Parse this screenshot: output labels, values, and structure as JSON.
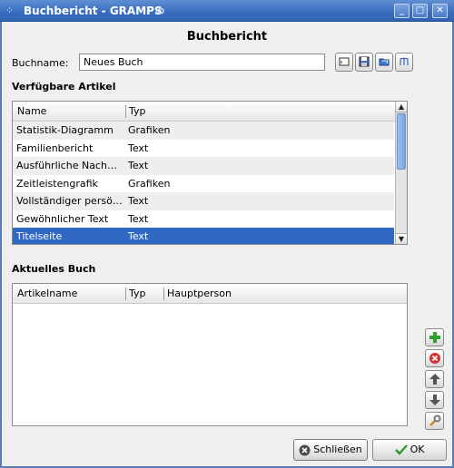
{
  "window": {
    "title": "Buchbericht - GRAMPS",
    "menu_icon": "window-menu-icon",
    "controls": {
      "minimize": "_",
      "maximize": "□",
      "close": "✕"
    }
  },
  "dialog": {
    "heading": "Buchbericht",
    "bookname_label": "Buchname:",
    "bookname_value": "Neues Buch",
    "toolbar_icons": [
      "clear-book-icon",
      "save-book-icon",
      "open-book-icon",
      "edit-books-icon"
    ]
  },
  "available": {
    "section_label": "Verfügbare Artikel",
    "columns": [
      "Name",
      "Typ"
    ],
    "rows": [
      {
        "name": "Statistik-Diagramm",
        "type": "Grafiken"
      },
      {
        "name": "Familienbericht",
        "type": "Text"
      },
      {
        "name": "Ausführliche Nach…",
        "type": "Text"
      },
      {
        "name": "Zeitleistengrafik",
        "type": "Grafiken"
      },
      {
        "name": "Vollständiger persö…",
        "type": "Text"
      },
      {
        "name": "Gewöhnlicher Text",
        "type": "Text"
      },
      {
        "name": "Titelseite",
        "type": "Text"
      }
    ],
    "selected_index": 6
  },
  "current": {
    "section_label": "Aktuelles Buch",
    "columns": [
      "Artikelname",
      "Typ",
      "Hauptperson"
    ],
    "rows": []
  },
  "side_buttons": [
    "add-icon",
    "remove-icon",
    "move-up-icon",
    "move-down-icon",
    "configure-icon"
  ],
  "buttons": {
    "close_label": "Schließen",
    "ok_label": "OK"
  },
  "colors": {
    "selection": "#3168c4",
    "titlebar": "#3a6fc0"
  }
}
